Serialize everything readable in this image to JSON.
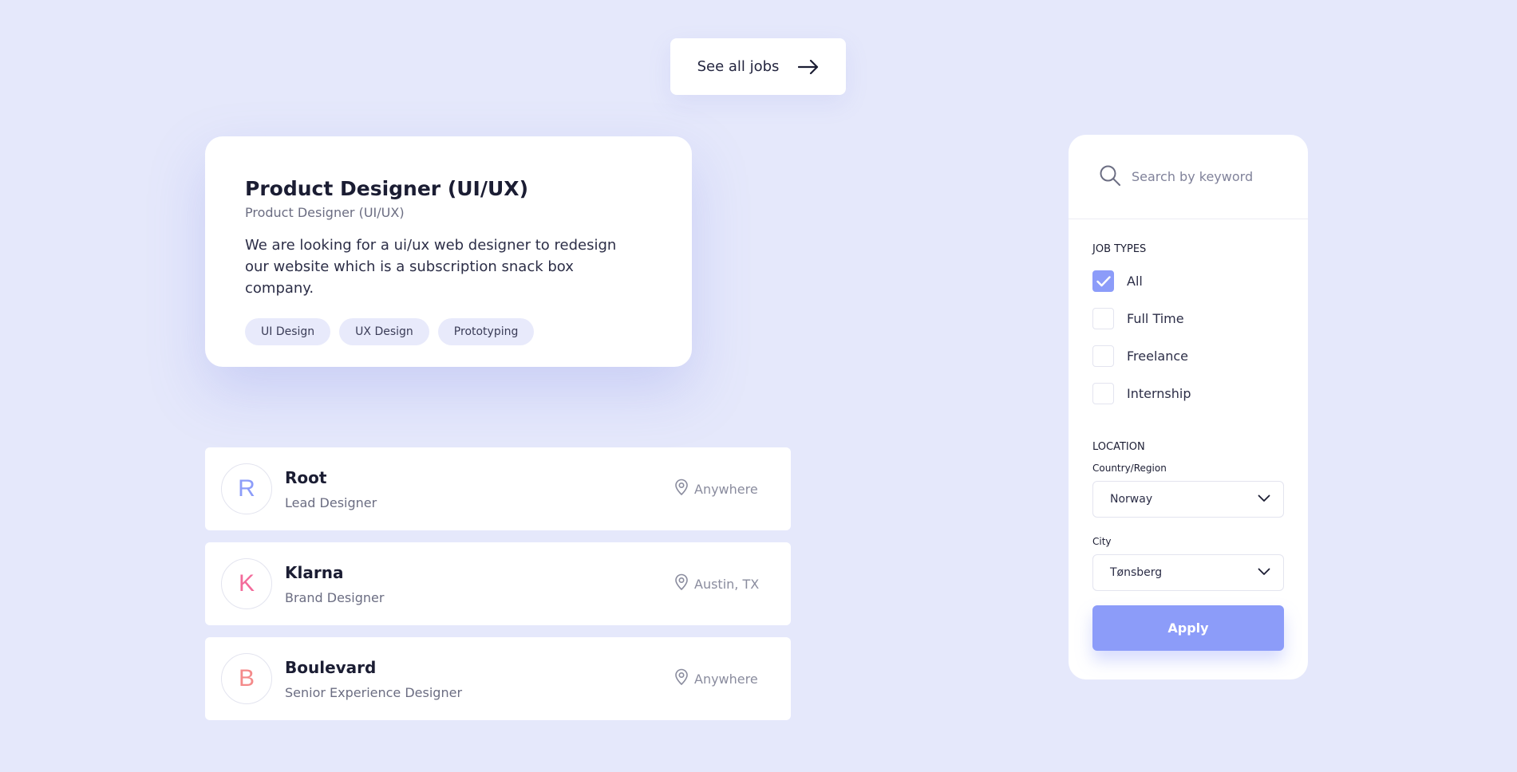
{
  "header": {
    "see_all_label": "See all jobs",
    "arrow_icon": "arrow-right-icon"
  },
  "featured": {
    "title": "Product Designer (UI/UX)",
    "subtitle": "Product Designer (UI/UX)",
    "description": "We are looking for a ui/ux web designer to redesign our website which is a subscription snack box company.",
    "tags": [
      "UI Design",
      "UX Design",
      "Prototyping"
    ]
  },
  "jobs": [
    {
      "initial": "R",
      "initial_color": "#8c9cf9",
      "company": "Root",
      "role": "Lead Designer",
      "location": "Anywhere"
    },
    {
      "initial": "K",
      "initial_color": "#f36a9a",
      "company": "Klarna",
      "role": "Brand Designer",
      "location": "Austin, TX"
    },
    {
      "initial": "B",
      "initial_color": "#f48a8a",
      "company": "Boulevard",
      "role": "Senior Experience Designer",
      "location": "Anywhere"
    }
  ],
  "filter": {
    "search_placeholder": "Search by keyword",
    "job_types_label": "JOB TYPES",
    "job_types": [
      {
        "label": "All",
        "checked": true
      },
      {
        "label": "Full Time",
        "checked": false
      },
      {
        "label": "Freelance",
        "checked": false
      },
      {
        "label": "Internship",
        "checked": false
      }
    ],
    "location_label": "LOCATION",
    "country_label": "Country/Region",
    "country_value": "Norway",
    "city_label": "City",
    "city_value": "Tønsberg",
    "apply_label": "Apply"
  },
  "colors": {
    "background": "#e5e8fb",
    "accent": "#8c9cf9",
    "tag_background": "#e8eafb"
  }
}
